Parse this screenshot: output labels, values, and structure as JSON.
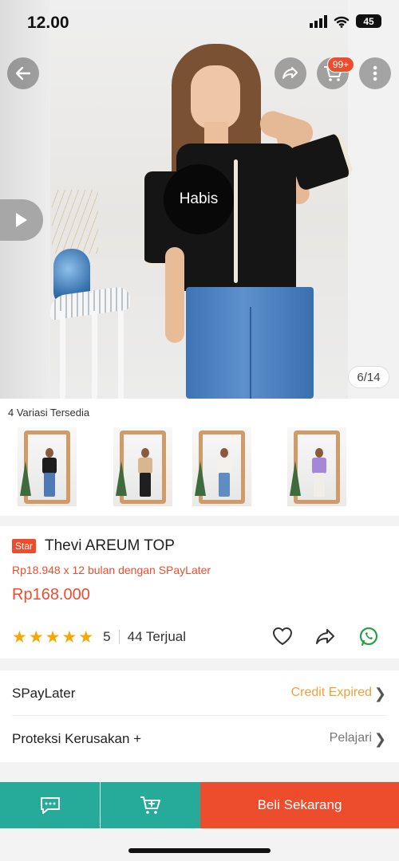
{
  "status_bar": {
    "time": "12.00",
    "battery": "45"
  },
  "hero": {
    "sold_out_label": "Habis",
    "image_counter": "6/14",
    "cart_badge": "99+",
    "icons": {
      "back": "arrow-left-icon",
      "share": "share-icon",
      "cart": "cart-icon",
      "more": "more-vertical-icon",
      "video": "play-icon"
    }
  },
  "variations": {
    "title": "4 Variasi Tersedia",
    "items": [
      {
        "top_color": "#1d1d1d",
        "bottom_color": "#4d79b7"
      },
      {
        "top_color": "#d8b78f",
        "bottom_color": "#1f1f1f"
      },
      {
        "top_color": "#f4f1ea",
        "bottom_color": "#5e8dc4"
      },
      {
        "top_color": "#a586d9",
        "bottom_color": "#f1eee7"
      }
    ]
  },
  "product": {
    "badge": "Star",
    "name": "Thevi AREUM TOP",
    "installment": "Rp18.948 x 12 bulan dengan SPayLater",
    "price": "Rp168.000",
    "rating": "5",
    "stars": 5,
    "sold": "44 Terjual"
  },
  "list": {
    "rows": [
      {
        "label": "SPayLater",
        "value": "Credit Expired",
        "value_color": "#f0a13a"
      },
      {
        "label": "Proteksi Kerusakan +",
        "value": "Pelajari",
        "value_color": "#777777"
      }
    ]
  },
  "bottom_bar": {
    "buy_label": "Beli Sekarang"
  },
  "colors": {
    "accent": "#ee4d2d",
    "teal": "#26aa99",
    "star": "#f6a700"
  }
}
